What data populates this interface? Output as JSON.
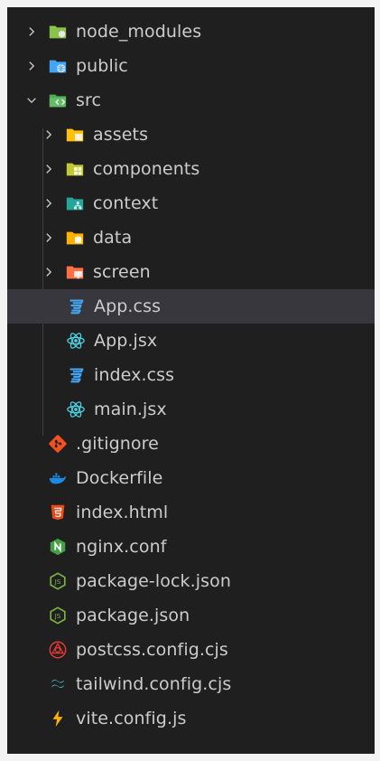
{
  "explorer": {
    "items": [
      {
        "label": "node_modules",
        "icon": "folder-node-icon",
        "type": "folder",
        "expanded": false
      },
      {
        "label": "public",
        "icon": "folder-public-icon",
        "type": "folder",
        "expanded": false
      },
      {
        "label": "src",
        "icon": "folder-src-icon",
        "type": "folder",
        "expanded": true
      },
      {
        "label": "assets",
        "icon": "folder-assets-icon",
        "type": "folder",
        "expanded": false
      },
      {
        "label": "components",
        "icon": "folder-components-icon",
        "type": "folder",
        "expanded": false
      },
      {
        "label": "context",
        "icon": "folder-context-icon",
        "type": "folder",
        "expanded": false
      },
      {
        "label": "data",
        "icon": "folder-data-icon",
        "type": "folder",
        "expanded": false
      },
      {
        "label": "screen",
        "icon": "folder-screen-icon",
        "type": "folder",
        "expanded": false
      },
      {
        "label": "App.css",
        "icon": "css-file-icon",
        "type": "file",
        "selected": true
      },
      {
        "label": "App.jsx",
        "icon": "react-file-icon",
        "type": "file"
      },
      {
        "label": "index.css",
        "icon": "css-file-icon",
        "type": "file"
      },
      {
        "label": "main.jsx",
        "icon": "react-file-icon",
        "type": "file"
      },
      {
        "label": ".gitignore",
        "icon": "git-file-icon",
        "type": "file"
      },
      {
        "label": "Dockerfile",
        "icon": "docker-file-icon",
        "type": "file"
      },
      {
        "label": "index.html",
        "icon": "html-file-icon",
        "type": "file"
      },
      {
        "label": "nginx.conf",
        "icon": "nginx-file-icon",
        "type": "file"
      },
      {
        "label": "package-lock.json",
        "icon": "nodejs-file-icon",
        "type": "file"
      },
      {
        "label": "package.json",
        "icon": "nodejs-file-icon",
        "type": "file"
      },
      {
        "label": "postcss.config.cjs",
        "icon": "postcss-file-icon",
        "type": "file"
      },
      {
        "label": "tailwind.config.cjs",
        "icon": "tailwind-file-icon",
        "type": "file"
      },
      {
        "label": "vite.config.js",
        "icon": "vite-file-icon",
        "type": "file"
      }
    ]
  },
  "colors": {
    "background": "#1f1f1f",
    "text": "#cccccc",
    "selected_row": "#37373d"
  }
}
